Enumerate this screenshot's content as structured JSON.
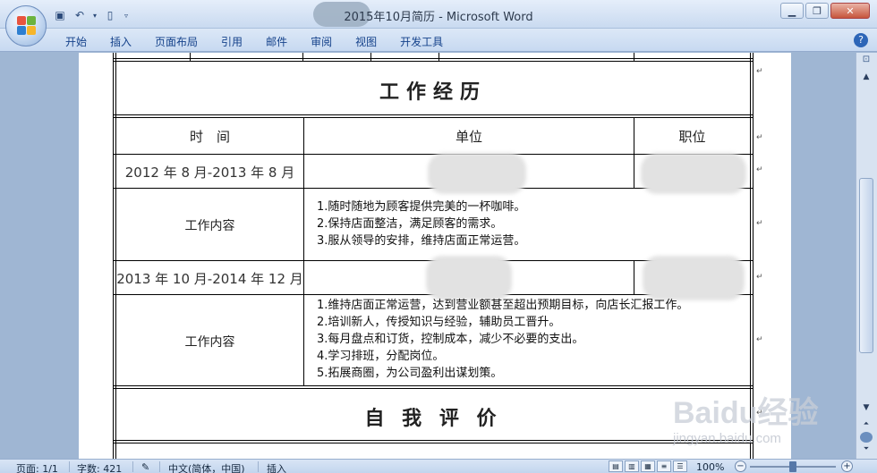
{
  "window": {
    "title": "2015年10月简历 - Microsoft Word"
  },
  "ribbon": {
    "tabs": [
      "开始",
      "插入",
      "页面布局",
      "引用",
      "邮件",
      "审阅",
      "视图",
      "开发工具"
    ]
  },
  "document": {
    "section_title": "工作经历",
    "header": {
      "time": "时　间",
      "unit": "单位",
      "position": "职位"
    },
    "jobs": [
      {
        "period": "2012 年 8 月-2013 年 8 月",
        "content_label": "工作内容",
        "duties": [
          "1.随时随地为顾客提供完美的一杯咖啡。",
          "2.保持店面整洁，满足顾客的需求。",
          "3.服从领导的安排，维持店面正常运营。"
        ]
      },
      {
        "period": "2013 年 10 月-2014 年 12 月",
        "content_label": "工作内容",
        "duties": [
          "1.维持店面正常运营，达到营业额甚至超出预期目标，向店长汇报工作。",
          "2.培训新人，传授知识与经验，辅助员工晋升。",
          "3.每月盘点和订货，控制成本，减少不必要的支出。",
          "4.学习排班，分配岗位。",
          "5.拓展商圈，为公司盈利出谋划策。"
        ]
      }
    ],
    "next_section_title": "自 我 评 价",
    "paragraph_mark": "↵"
  },
  "statusbar": {
    "page": "页面: 1/1",
    "words": "字数: 421",
    "language": "中文(简体，中国)",
    "mode": "插入",
    "zoom": "100%"
  },
  "watermark": {
    "logo": "Baidu经验",
    "url": "jingyan.baidu.com"
  }
}
